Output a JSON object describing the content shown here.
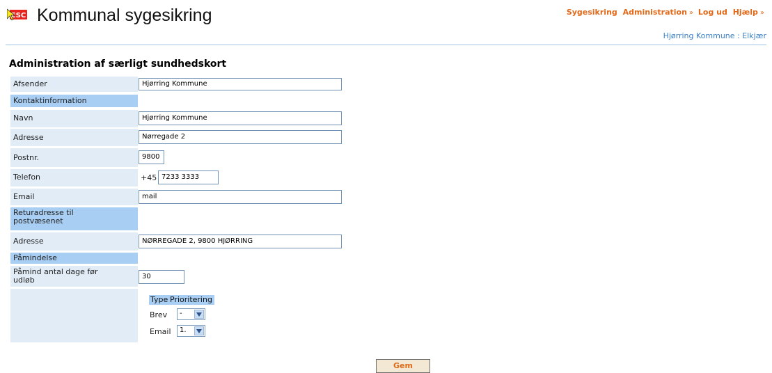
{
  "app": {
    "logo_text": "ESC",
    "title": "Kommunal sygesikring"
  },
  "topnav": {
    "item1": "Sygesikring",
    "item2": "Administration",
    "item3": "Log ud",
    "item4": "Hjælp",
    "chevron": "»"
  },
  "user_line": "Hjørring Kommune : Elkjær",
  "page_title": "Administration af særligt sundhedskort",
  "form": {
    "afsender": {
      "label": "Afsender",
      "value": "Hjørring Kommune"
    },
    "kontakt_section": "Kontaktinformation",
    "navn": {
      "label": "Navn",
      "value": "Hjørring Kommune"
    },
    "adresse": {
      "label": "Adresse",
      "value": "Nørregade 2"
    },
    "postnr": {
      "label": "Postnr.",
      "value": "9800"
    },
    "telefon": {
      "label": "Telefon",
      "prefix": "+45",
      "value": "7233 3333"
    },
    "email": {
      "label": "Email",
      "value": "mail"
    },
    "retur_section": "Returadresse til postvæsenet",
    "retur_adresse": {
      "label": "Adresse",
      "value": "NØRREGADE 2, 9800 HJØRRING"
    },
    "paamind_section": "Påmindelse",
    "paamind_dage": {
      "label": "Påmind antal dage før udløb",
      "value": "30"
    },
    "priority": {
      "header_type": "Type",
      "header_priority": "Prioritering",
      "rows": [
        {
          "type": "Brev",
          "selected": "-"
        },
        {
          "type": "Email",
          "selected": "1."
        }
      ]
    }
  },
  "save_button": "Gem"
}
